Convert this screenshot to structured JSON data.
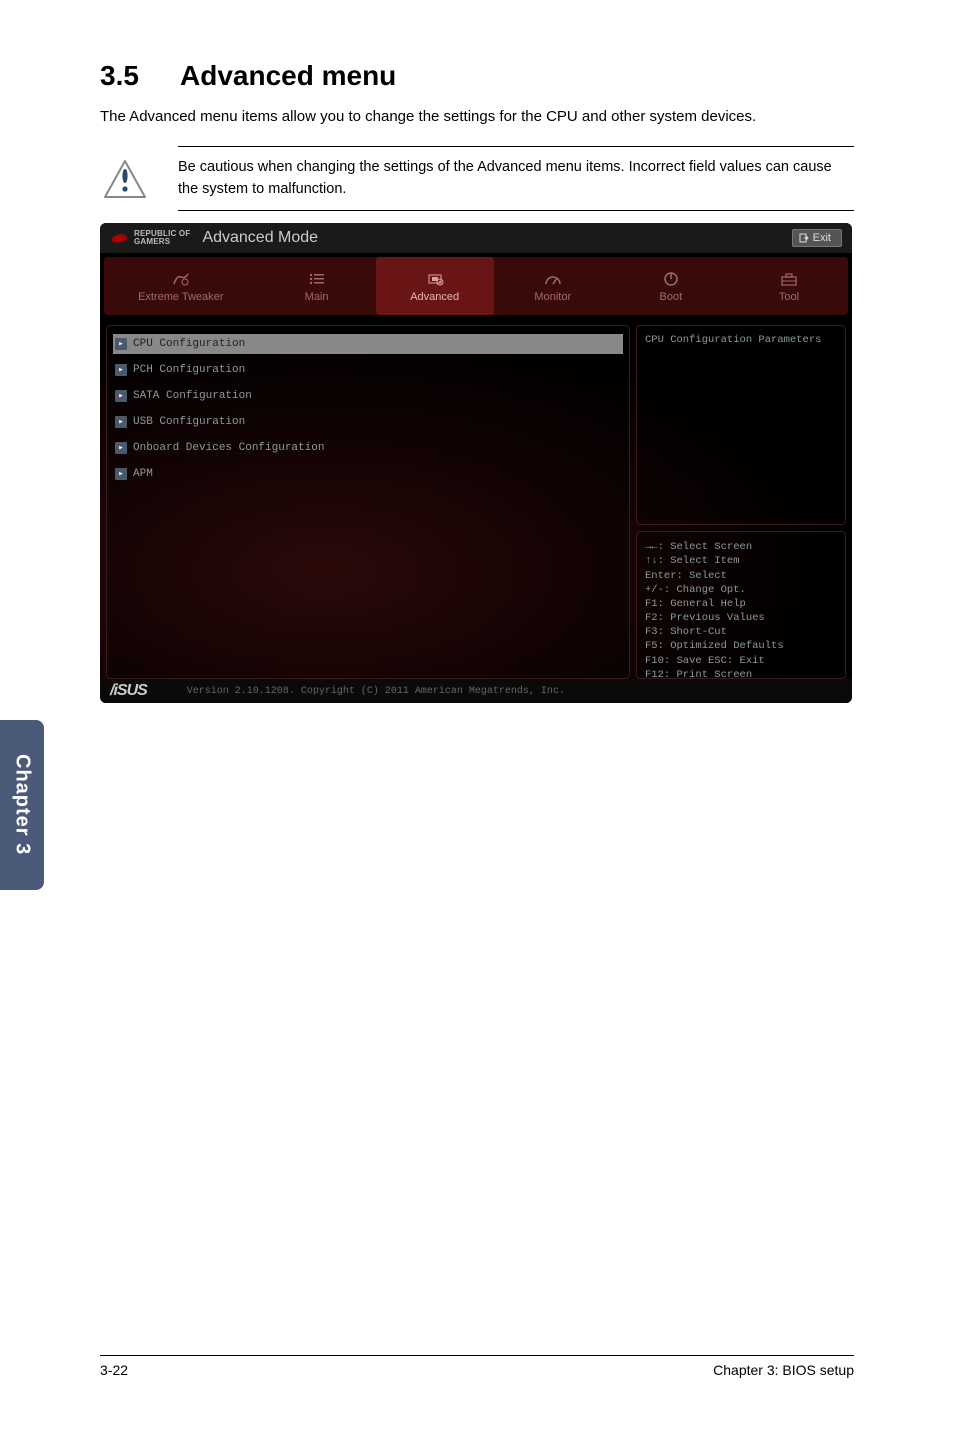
{
  "heading_num": "3.5",
  "heading_title": "Advanced menu",
  "intro": "The Advanced menu items allow you to change the settings for the CPU and other system devices.",
  "note": "Be cautious when changing the settings of the Advanced menu items. Incorrect field values can cause the system to malfunction.",
  "bios": {
    "brand_top": "REPUBLIC OF",
    "brand_bottom": "GAMERS",
    "mode": "Advanced Mode",
    "exit": "Exit",
    "tabs": {
      "t0": "Extreme Tweaker",
      "t1": "Main",
      "t2": "Advanced",
      "t3": "Monitor",
      "t4": "Boot",
      "t5": "Tool"
    },
    "menu": {
      "m0": "CPU Configuration",
      "m1": "PCH Configuration",
      "m2": "SATA Configuration",
      "m3": "USB Configuration",
      "m4": "Onboard Devices Configuration",
      "m5": "APM"
    },
    "help_title": "CPU Configuration Parameters",
    "keys": {
      "k0": "→←: Select Screen",
      "k1": "↑↓: Select Item",
      "k2": "Enter: Select",
      "k3": "+/-: Change Opt.",
      "k4": "F1: General Help",
      "k5": "F2: Previous Values",
      "k6": "F3: Short-Cut",
      "k7": "F5: Optimized Defaults",
      "k8": "F10: Save  ESC: Exit",
      "k9": "F12: Print Screen"
    },
    "vendor": "/‌iSUS",
    "copyright": "Version 2.10.1208. Copyright (C) 2011 American Megatrends, Inc."
  },
  "chapter_tab": "Chapter 3",
  "footer_left": "3-22",
  "footer_right": "Chapter 3: BIOS setup"
}
